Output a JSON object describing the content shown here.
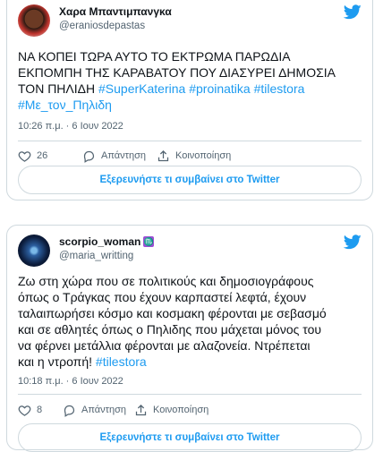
{
  "tweets": [
    {
      "name": "Χαρα Μπαντιμπανγκα",
      "handle": "@eraniosdepastas",
      "text_line1": "ΝΑ ΚΟΠΕΙ ΤΩΡΑ ΑΥΤΟ ΤΟ ΕΚΤΡΩΜΑ ΠΑΡΩΔΙΑ",
      "text_line2": "ΕΚΠΟΜΠΗ ΤΗΣ ΚΑΡΑΒΑΤΟΥ ΠΟΥ ΔΙΑΣΥΡΕΙ ΔΗΜΟΣΙΑ",
      "text_line3_plain": "ΤΟΝ ΠΗΛΙΔΗ ",
      "hashtags_line3": [
        "#SuperKaterina",
        "#proinatika",
        "#tilestora"
      ],
      "hashtags_line4": [
        "#Με_τον_Πηλιδη"
      ],
      "timestamp": "10:26 π.μ. · 6 Ιουν 2022",
      "likes": "26",
      "reply_label": "Απάντηση",
      "share_label": "Κοινοποίηση",
      "explore_label": "Εξερευνήστε τι συμβαίνει στο Twitter"
    },
    {
      "name": "scorpio_woman",
      "badge": "♏",
      "handle": "@maria_writting",
      "lines": [
        "Ζω στη χώρα που σε πολιτικούς και δημοσιογράφους",
        "όπως ο Τράγκας που έχουν καρπαστεί λεφτά, έχουν",
        "ταλαιπωρήσει κόσμο και κοσμακη φέρονται με σεβασμό",
        "και σε αθλητές όπως ο Πηλιδης που μάχεται μόνος του",
        "να φέρνει μετάλλια φέρονται με αλαζονεία. Ντρέπεται"
      ],
      "last_line_plain": "και η ντροπή! ",
      "last_line_hashtag": "#tilestora",
      "timestamp": "10:18 π.μ. · 6 Ιουν 2022",
      "likes": "8",
      "reply_label": "Απάντηση",
      "share_label": "Κοινοποίηση",
      "explore_label": "Εξερευνήστε τι συμβαίνει στο Twitter"
    }
  ],
  "colors": {
    "accent": "#1d9bf0",
    "like_red": "#f91880",
    "muted": "#536471",
    "border": "#cfd9de"
  }
}
